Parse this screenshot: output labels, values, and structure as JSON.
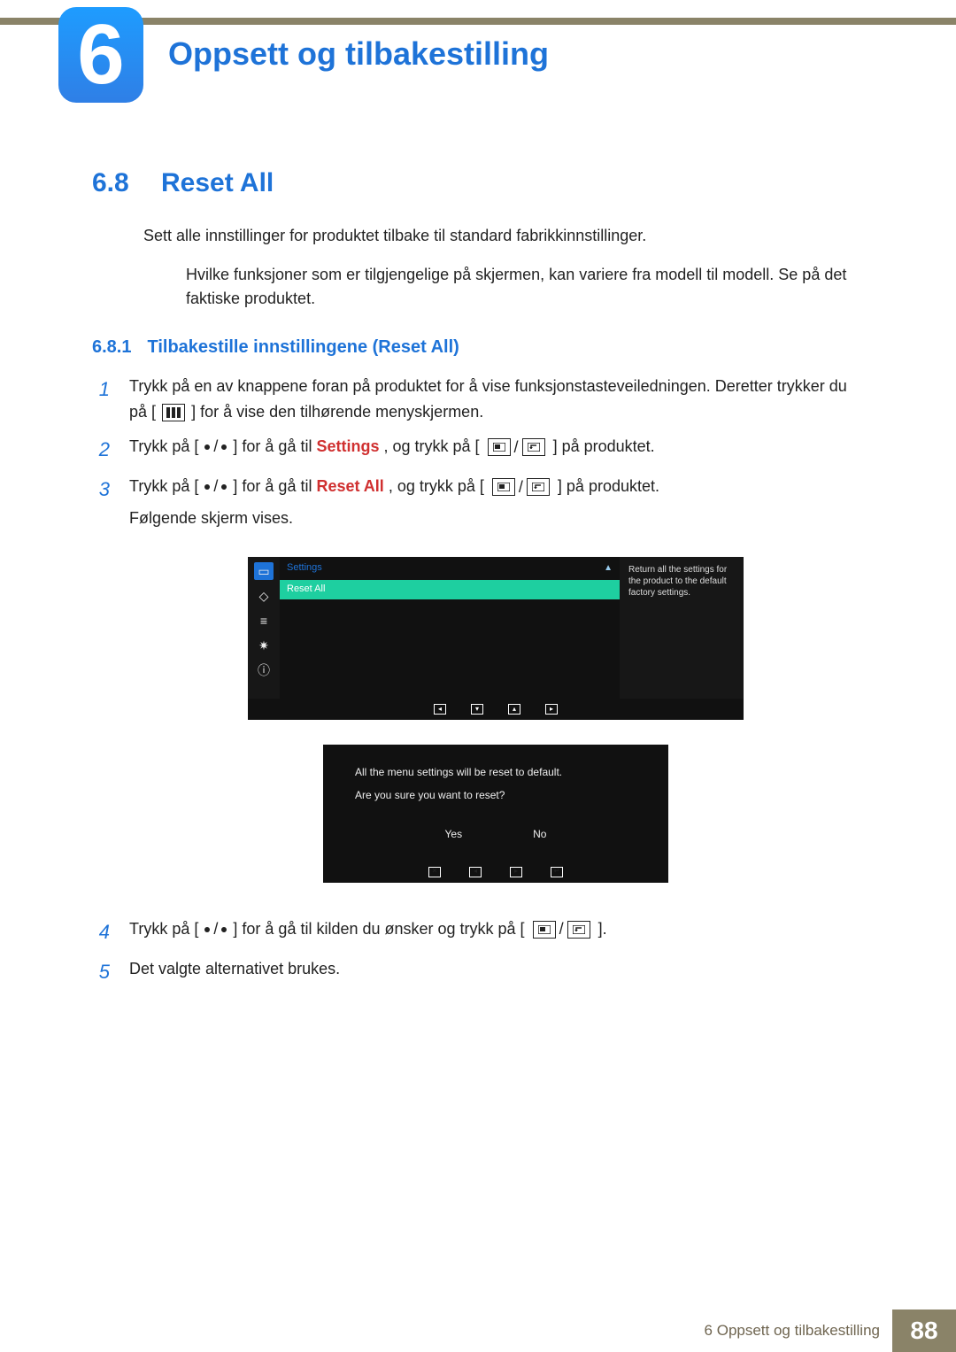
{
  "chapter": {
    "number": "6",
    "title": "Oppsett og tilbakestilling"
  },
  "section": {
    "number": "6.8",
    "title": "Reset All"
  },
  "intro": "Sett alle innstillinger for produktet tilbake til standard fabrikkinnstillinger.",
  "note": "Hvilke funksjoner som er tilgjengelige på skjermen, kan variere fra modell til modell. Se på det faktiske produktet.",
  "subsection": {
    "number": "6.8.1",
    "title": "Tilbakestille innstillingene (Reset All)"
  },
  "step1": {
    "a": "Trykk på en av knappene foran på produktet for å vise funksjonstasteveiledningen. Deretter trykker du på [",
    "b": "] for å vise den tilhørende menyskjermen."
  },
  "step2": {
    "a": "Trykk på [",
    "b": "] for å gå til ",
    "c": ", og trykk på [",
    "d": "] på produktet.",
    "kw": "Settings"
  },
  "step3": {
    "a": "Trykk på [",
    "b": "] for å gå til ",
    "c": ", og trykk på [",
    "d": "] på produktet.",
    "kw": "Reset All",
    "e": "Følgende skjerm vises."
  },
  "osd1": {
    "header": "Settings",
    "rowSelected": "Reset All",
    "help": "Return all the settings for the product to the default factory settings."
  },
  "osd2": {
    "line1": "All the menu settings will be reset to default.",
    "line2": "Are you sure you want to reset?",
    "yes": "Yes",
    "no": "No"
  },
  "step4": {
    "a": "Trykk på [",
    "b": "] for å gå til kilden du ønsker og trykk på [",
    "c": "]."
  },
  "step5": "Det valgte alternativet brukes.",
  "footer": {
    "text": "6 Oppsett og tilbakestilling",
    "page": "88"
  }
}
